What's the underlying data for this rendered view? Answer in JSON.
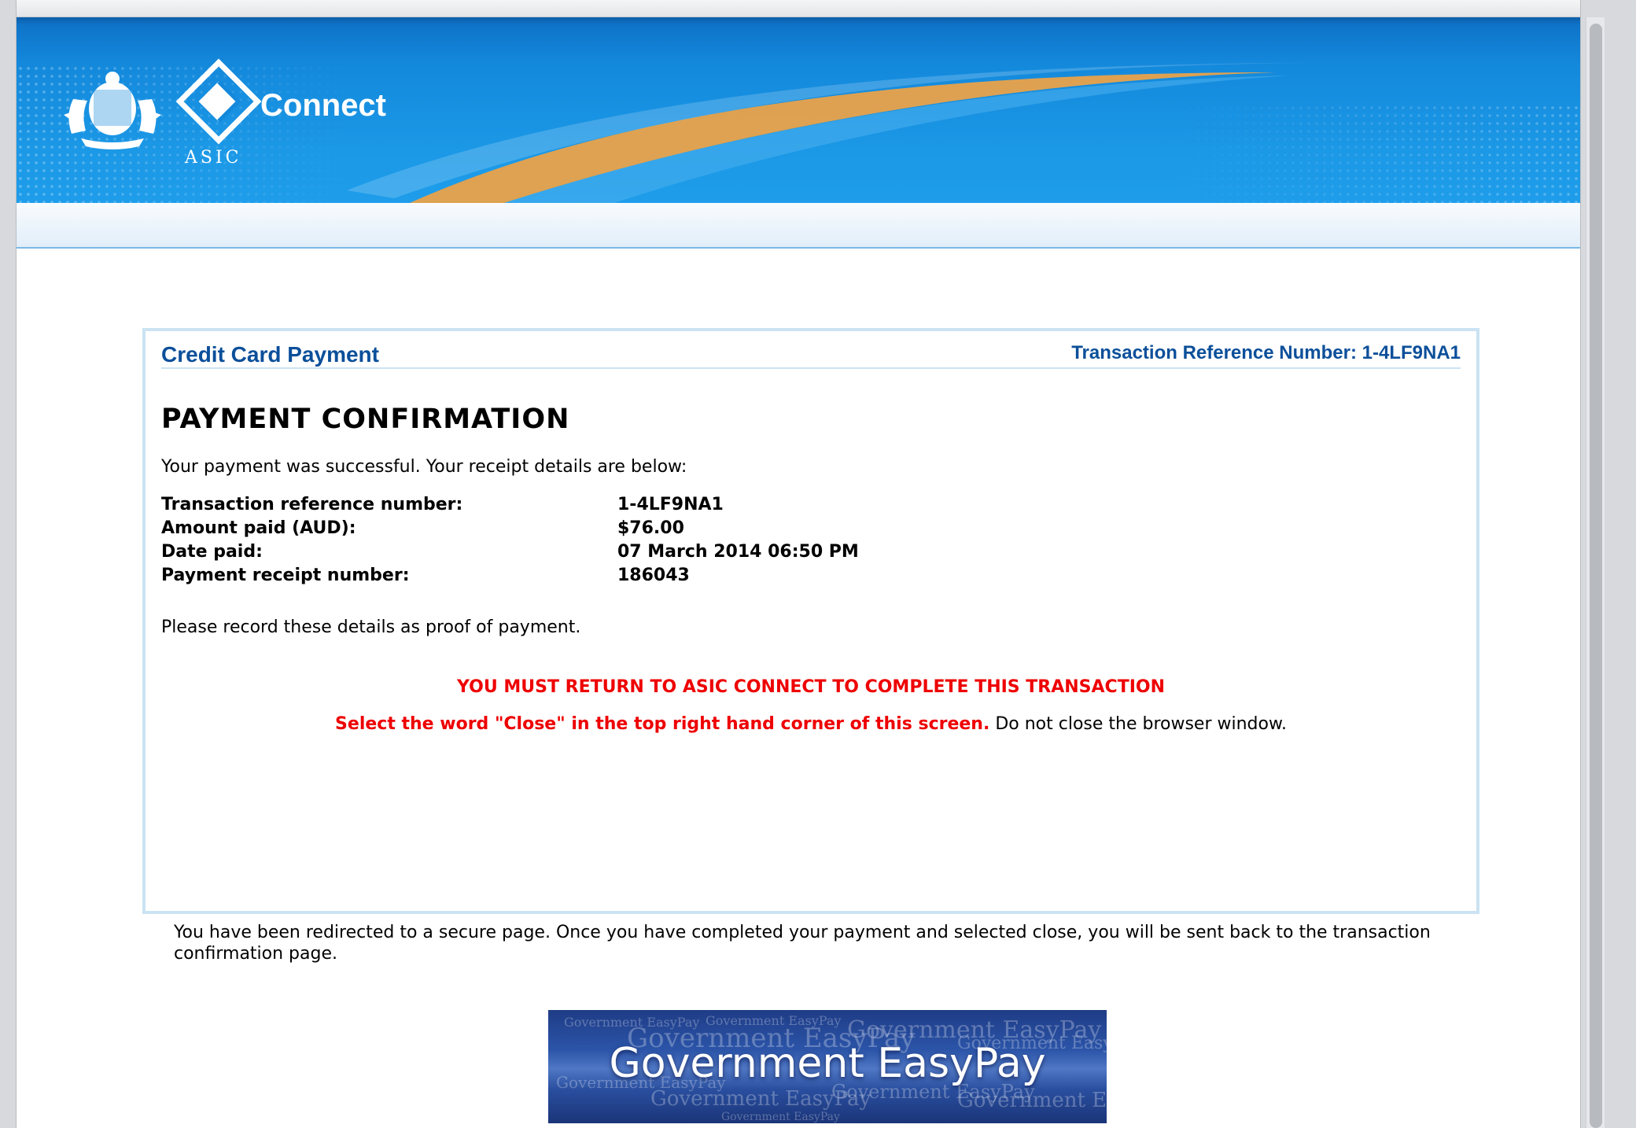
{
  "header": {
    "org_label": "ASIC",
    "app_name": "Connect"
  },
  "panel": {
    "title": "Credit Card Payment",
    "transaction_reference_header": "Transaction Reference Number: 1-4LF9NA1",
    "heading": "PAYMENT CONFIRMATION",
    "success_message": "Your payment was successful. Your receipt details are below:",
    "details": [
      {
        "label": "Transaction reference number:",
        "value": "1-4LF9NA1"
      },
      {
        "label": "Amount paid (AUD):",
        "value": "$76.00"
      },
      {
        "label": "Date paid:",
        "value": "07 March 2014 06:50 PM"
      },
      {
        "label": "Payment receipt number:",
        "value": "186043"
      }
    ],
    "record_message": "Please record these details as proof of payment.",
    "must_return_warning": "YOU MUST RETURN TO ASIC CONNECT TO COMPLETE THIS TRANSACTION",
    "close_instruction_red": "Select the word \"Close\" in the top right hand corner of this screen.",
    "close_instruction_black": " Do not close the browser window."
  },
  "redirect_message": "You have been redirected to a secure page. Once you have completed your payment and selected close, you will be sent back to the transaction confirmation page.",
  "easypay_logo": {
    "title": "Government EasyPay",
    "background_text": "Government EasyPay"
  },
  "colors": {
    "banner_blue": "#1489dc",
    "swoosh_orange": "#e9a24a",
    "heading_blue": "#0b4f9a",
    "warning_red": "#ee0000",
    "panel_border": "#cbe3f3"
  }
}
